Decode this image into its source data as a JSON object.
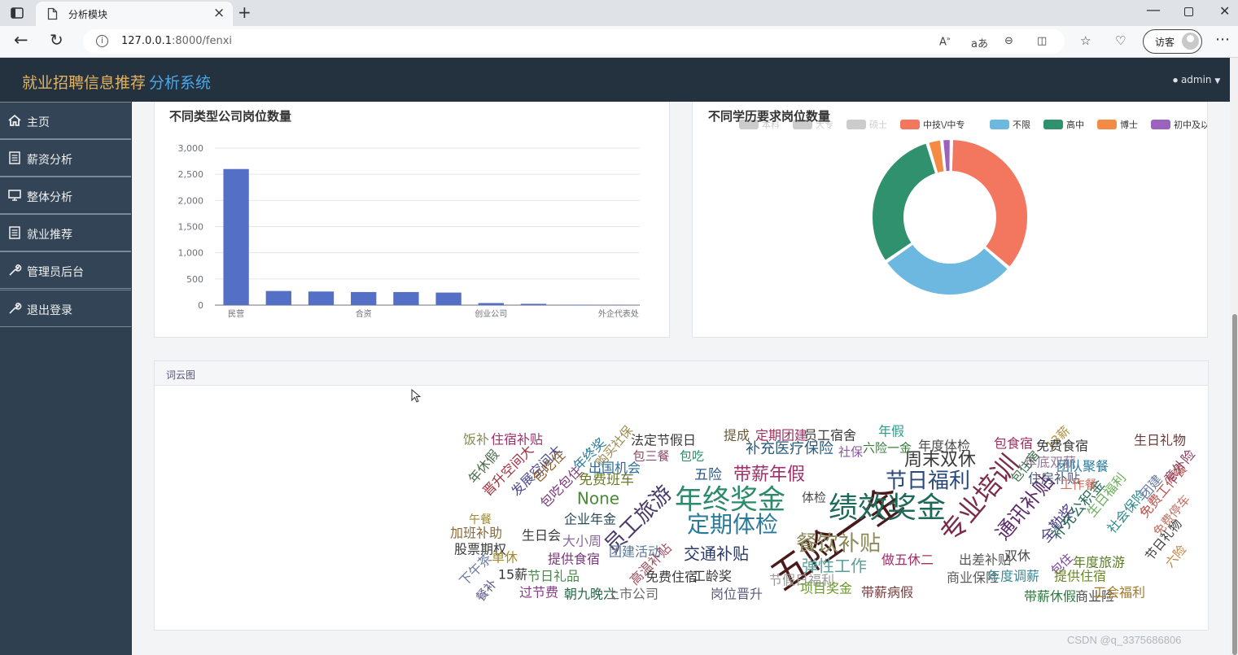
{
  "browser": {
    "tab_title": "分析模块",
    "url_host": "127.0.0.1",
    "url_path": ":8000/fenxi",
    "guest_label": "访客"
  },
  "header": {
    "brand_main": "就业招聘信息推荐",
    "brand_accent": "分析系统",
    "user_menu": "admin"
  },
  "sidebar": {
    "items": [
      {
        "label": "主页",
        "icon": "home-icon"
      },
      {
        "label": "薪资分析",
        "icon": "document-icon"
      },
      {
        "label": "整体分析",
        "icon": "monitor-icon"
      },
      {
        "label": "就业推荐",
        "icon": "document-icon"
      },
      {
        "label": "管理员后台",
        "icon": "wrench-icon"
      },
      {
        "label": "退出登录",
        "icon": "wrench-icon"
      }
    ]
  },
  "panels": {
    "bar_title": "不同类型公司岗位数量",
    "donut_title": "不同学历要求岗位数量",
    "wordcloud_title": "词云图"
  },
  "watermark": "CSDN @q_3375686806",
  "chart_data": [
    {
      "type": "bar",
      "title": "不同类型公司岗位数量",
      "categories": [
        "民营",
        "",
        "",
        "合资",
        "",
        "",
        "创业公司",
        "",
        "",
        "外企代表处"
      ],
      "values": [
        2600,
        270,
        260,
        250,
        250,
        240,
        40,
        25,
        8,
        4
      ],
      "yticks": [
        "0",
        "500",
        "1,000",
        "1,500",
        "2,000",
        "2,500",
        "3,000"
      ],
      "ylim": [
        0,
        3000
      ],
      "color": "#5470c6",
      "grid": true
    },
    {
      "type": "pie",
      "title": "不同学历要求岗位数量",
      "legend_position": "top",
      "legend": [
        {
          "name": "本科",
          "color": "#cccccc",
          "inactive": true
        },
        {
          "name": "大专",
          "color": "#cccccc",
          "inactive": true
        },
        {
          "name": "硕士",
          "color": "#cccccc",
          "inactive": true
        },
        {
          "name": "中技\\/中专",
          "color": "#f3765f"
        },
        {
          "name": "不限",
          "color": "#6db8e0"
        },
        {
          "name": "高中",
          "color": "#30916e"
        },
        {
          "name": "博士",
          "color": "#f48b45"
        },
        {
          "name": "初中及以下",
          "color": "#9b62bf"
        }
      ],
      "slices": [
        {
          "name": "中技\\/中专",
          "value": 36,
          "color": "#f3765f"
        },
        {
          "name": "不限",
          "value": 29,
          "color": "#6db8e0"
        },
        {
          "name": "高中",
          "value": 30,
          "color": "#30916e"
        },
        {
          "name": "博士",
          "value": 3,
          "color": "#f48b45"
        },
        {
          "name": "初中及以下",
          "value": 2,
          "color": "#9b62bf"
        }
      ]
    },
    {
      "type": "wordcloud",
      "title": "词云图",
      "words": [
        {
          "t": "五险一金",
          "s": 46,
          "c": "#4a1a1a",
          "r": -35
        },
        {
          "t": "绩效奖金",
          "s": 36,
          "c": "#1e6a5a"
        },
        {
          "t": "年终奖金",
          "s": 34,
          "c": "#2a8a6a"
        },
        {
          "t": "专业培训",
          "s": 32,
          "c": "#7a2a4a",
          "r": -50
        },
        {
          "t": "定期体检",
          "s": 28,
          "c": "#2a7a9a"
        },
        {
          "t": "员工旅游",
          "s": 26,
          "c": "#4a3a6a",
          "r": -45
        },
        {
          "t": "餐饮补贴",
          "s": 26,
          "c": "#8a8a5a"
        },
        {
          "t": "节日福利",
          "s": 26,
          "c": "#2a4a7a"
        },
        {
          "t": "通讯补贴",
          "s": 24,
          "c": "#5a2a6a",
          "r": -50
        },
        {
          "t": "带薪年假",
          "s": 22,
          "c": "#a0306a"
        },
        {
          "t": "周末双休",
          "s": 22,
          "c": "#3a3a3a"
        },
        {
          "t": "交通补贴",
          "s": 20,
          "c": "#2a3a6a"
        },
        {
          "t": "弹性工作",
          "s": 20,
          "c": "#5aa09a"
        },
        {
          "t": "补充医疗保险",
          "s": 18,
          "c": "#2a5a7a"
        },
        {
          "t": "做五休二",
          "s": 16,
          "c": "#a0306a"
        },
        {
          "t": "None",
          "s": 20,
          "c": "#4a8a3a"
        },
        {
          "t": "免费班车",
          "s": 17,
          "c": "#6a7a2a"
        },
        {
          "t": "全勤奖",
          "s": 18,
          "c": "#4a3a8a",
          "r": -50
        },
        {
          "t": "补充公积金",
          "s": 18,
          "c": "#2a6a5a",
          "r": -50
        },
        {
          "t": "社会保险",
          "s": 16,
          "c": "#2a8a8a",
          "r": -50
        },
        {
          "t": "生日福利",
          "s": 16,
          "c": "#6ab05a",
          "r": -50
        },
        {
          "t": "免费工作餐",
          "s": 16,
          "c": "#c0504a",
          "r": -50
        },
        {
          "t": "团建",
          "s": 16,
          "c": "#6a7aa0",
          "r": -50
        },
        {
          "t": "意外险",
          "s": 16,
          "c": "#8a3a5a",
          "r": -50
        },
        {
          "t": "免费停车",
          "s": 15,
          "c": "#c07060",
          "r": -50
        },
        {
          "t": "节日礼物",
          "s": 15,
          "c": "#3a3a3a",
          "r": -50
        },
        {
          "t": "六险",
          "s": 15,
          "c": "#c08040",
          "r": -50
        },
        {
          "t": "饭补",
          "s": 16,
          "c": "#8a8a5a"
        },
        {
          "t": "住宿补贴",
          "s": 16,
          "c": "#a0306a"
        },
        {
          "t": "年休假",
          "s": 16,
          "c": "#4a6a4a",
          "r": -50
        },
        {
          "t": "晋升空间大",
          "s": 16,
          "c": "#a03040",
          "r": -45
        },
        {
          "t": "发展空间大",
          "s": 16,
          "c": "#4a4a8a",
          "r": -45
        },
        {
          "t": "包吃住",
          "s": 16,
          "c": "#8a5a2a",
          "r": -45
        },
        {
          "t": "年终奖",
          "s": 16,
          "c": "#2a7a9a",
          "r": -45
        },
        {
          "t": "包吃包住",
          "s": 16,
          "c": "#7a3a7a",
          "r": -45
        },
        {
          "t": "购买社保",
          "s": 15,
          "c": "#9a8a4a",
          "r": -50
        },
        {
          "t": "出国机会",
          "s": 16,
          "c": "#2a6a9a"
        },
        {
          "t": "法定节假日",
          "s": 16,
          "c": "#3a3a3a"
        },
        {
          "t": "包三餐",
          "s": 15,
          "c": "#8a4a6a"
        },
        {
          "t": "包吃",
          "s": 15,
          "c": "#2a8a6a"
        },
        {
          "t": "提成",
          "s": 16,
          "c": "#6a5a3a"
        },
        {
          "t": "定期团建",
          "s": 16,
          "c": "#a03060"
        },
        {
          "t": "员工宿舍",
          "s": 16,
          "c": "#3a3a3a"
        },
        {
          "t": "年假",
          "s": 16,
          "c": "#2a9a8a"
        },
        {
          "t": "社保",
          "s": 15,
          "c": "#8a5aa0"
        },
        {
          "t": "六险一金",
          "s": 15,
          "c": "#3a7a3a"
        },
        {
          "t": "年度体检",
          "s": 16,
          "c": "#4a4a4a"
        },
        {
          "t": "包食宿",
          "s": 16,
          "c": "#a03060"
        },
        {
          "t": "13薪",
          "s": 15,
          "c": "#b0903a",
          "r": -45
        },
        {
          "t": "免费食宿",
          "s": 16,
          "c": "#3a3a3a"
        },
        {
          "t": "生日礼物",
          "s": 16,
          "c": "#6a3a3a"
        },
        {
          "t": "年底双薪",
          "s": 16,
          "c": "#9a7a9a"
        },
        {
          "t": "团队聚餐",
          "s": 16,
          "c": "#2a7a9a"
        },
        {
          "t": "五险",
          "s": 17,
          "c": "#2a5a8a"
        },
        {
          "t": "包住宿",
          "s": 15,
          "c": "#3a6a4a",
          "r": -50
        },
        {
          "t": "住房补贴",
          "s": 16,
          "c": "#4a5a7a"
        },
        {
          "t": "工作餐",
          "s": 15,
          "c": "#d07060"
        },
        {
          "t": "体检",
          "s": 15,
          "c": "#4a4a4a"
        },
        {
          "t": "午餐",
          "s": 14,
          "c": "#9a8a2a"
        },
        {
          "t": "企业年金",
          "s": 16,
          "c": "#2a4a5a"
        },
        {
          "t": "加班补助",
          "s": 16,
          "c": "#8a6a3a"
        },
        {
          "t": "生日会",
          "s": 16,
          "c": "#3a3a3a"
        },
        {
          "t": "大小周",
          "s": 16,
          "c": "#8a6a9a"
        },
        {
          "t": "股票期权",
          "s": 16,
          "c": "#3a3a3a"
        },
        {
          "t": "单休",
          "s": 16,
          "c": "#a08a2a"
        },
        {
          "t": "提供食宿",
          "s": 16,
          "c": "#7a3a7a"
        },
        {
          "t": "团建活动",
          "s": 16,
          "c": "#5a7a9a"
        },
        {
          "t": "高温补贴",
          "s": 16,
          "c": "#a05060",
          "r": -45
        },
        {
          "t": "下午茶",
          "s": 16,
          "c": "#6a7aa0",
          "r": -45
        },
        {
          "t": "15薪",
          "s": 16,
          "c": "#3a3a3a"
        },
        {
          "t": "节日礼品",
          "s": 16,
          "c": "#4a8a4a"
        },
        {
          "t": "免费住宿",
          "s": 16,
          "c": "#3a3a3a"
        },
        {
          "t": "工龄奖",
          "s": 16,
          "c": "#3a3a3a"
        },
        {
          "t": "节假日福利",
          "s": 16,
          "c": "#9a9a9a"
        },
        {
          "t": "餐补",
          "s": 15,
          "c": "#5a5a8a",
          "r": -50
        },
        {
          "t": "过节费",
          "s": 16,
          "c": "#8a3a8a"
        },
        {
          "t": "朝九晚六",
          "s": 16,
          "c": "#2a6a4a"
        },
        {
          "t": "上市公司",
          "s": 16,
          "c": "#6a6a6a"
        },
        {
          "t": "岗位晋升",
          "s": 16,
          "c": "#5a5a7a"
        },
        {
          "t": "项目奖金",
          "s": 16,
          "c": "#6a9a2a"
        },
        {
          "t": "带薪病假",
          "s": 16,
          "c": "#7a3a3a"
        },
        {
          "t": "商业保险",
          "s": 16,
          "c": "#5a5a5a"
        },
        {
          "t": "年度调薪",
          "s": 16,
          "c": "#3a8a9a"
        },
        {
          "t": "出差补贴",
          "s": 16,
          "c": "#5a5a5a"
        },
        {
          "t": "双休",
          "s": 16,
          "c": "#4a4a4a"
        },
        {
          "t": "包住",
          "s": 15,
          "c": "#7a3a9a",
          "r": -45
        },
        {
          "t": "提供住宿",
          "s": 16,
          "c": "#6a8a2a"
        },
        {
          "t": "年度旅游",
          "s": 16,
          "c": "#5a7a2a"
        },
        {
          "t": "带薪休假",
          "s": 16,
          "c": "#2a7a3a"
        },
        {
          "t": "商业险",
          "s": 16,
          "c": "#4a4a4a"
        },
        {
          "t": "工会福利",
          "s": 16,
          "c": "#a07a2a"
        }
      ]
    }
  ]
}
